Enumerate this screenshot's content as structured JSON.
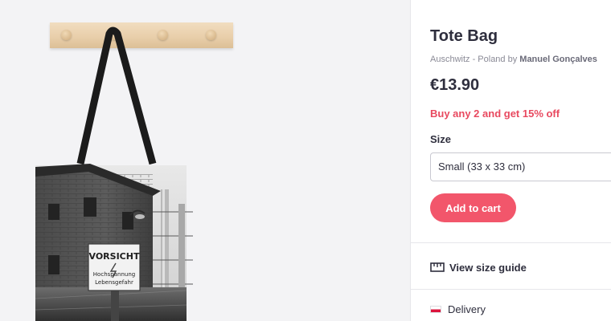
{
  "product": {
    "title": "Tote Bag",
    "location": "Auschwitz - Poland by ",
    "artist": "Manuel Gonçalves",
    "price": "€13.90",
    "promo": "Buy any 2 and get 15% off"
  },
  "size": {
    "label": "Size",
    "selected": "Small (33 x 33 cm)"
  },
  "actions": {
    "add_to_cart": "Add to cart",
    "size_guide": "View size guide"
  },
  "delivery": {
    "label": "Delivery",
    "flag": "poland-flag-icon"
  },
  "artwork": {
    "sign_line1": "VORSICHT",
    "sign_line2": "Hochspannung",
    "sign_line3": "Lebensgefahr"
  },
  "colors": {
    "accent": "#f2566b",
    "promo": "#e8495f",
    "text": "#2e2e3d",
    "muted": "#8a8a96"
  }
}
